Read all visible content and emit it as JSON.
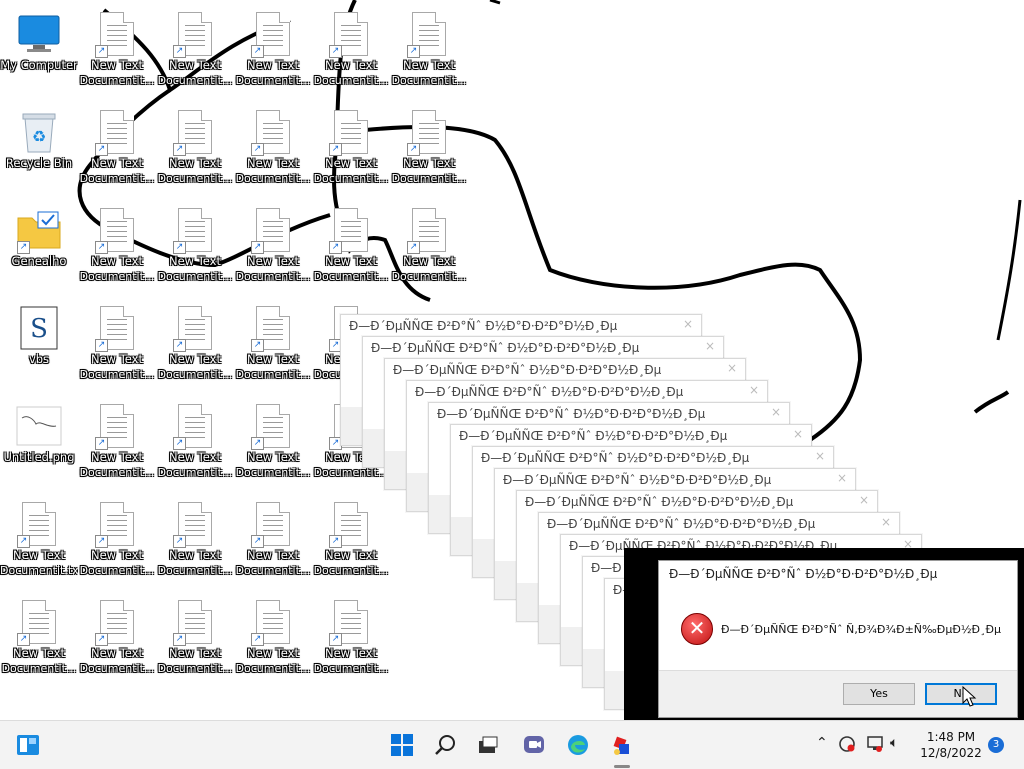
{
  "desktop": {
    "special_icons": {
      "my_computer": "My Computer",
      "recycle_bin": "Recycle Bin",
      "genealho": "Genealho",
      "vbs": "vbs",
      "untitled": "Untitled.png"
    },
    "text_files": [
      {
        "name": "New Text Documentit...",
        "label_lines": [
          "New Text",
          "Documentit..."
        ]
      },
      {
        "name": "New Text Documentit...",
        "label_lines": [
          "New Text",
          "Documentit..."
        ]
      },
      {
        "name": "New Text Documentit...",
        "label_lines": [
          "New Text",
          "Documentit..."
        ]
      },
      {
        "name": "New Text Documentit...",
        "label_lines": [
          "New Text",
          "Documentit..."
        ]
      },
      {
        "name": "New Text Documentit...",
        "label_lines": [
          "New Text",
          "Documentit..."
        ]
      },
      {
        "name": "New Text Documentit...",
        "label_lines": [
          "New Text",
          "Documentit..."
        ]
      }
    ],
    "doc_label_1": "New Text",
    "doc_label_2": "Documentit...",
    "doc_label_2_alt": "Documentit.txt"
  },
  "error_dialog": {
    "title": "Ð—Ð´ÐµÑÑŒ Ð²Ð°Ñˆ Ð½Ð°Ð·Ð²Ð°Ð½Ð¸Ðµ",
    "message": "Ð—Ð´ÐµÑÑŒ Ð²Ð°Ñˆ Ñ‚Ð¾Ð¾Ð±Ñ‰ÐµÐ½Ð¸Ðµ",
    "yes_label": "Yes",
    "no_label": "No",
    "close_glyph": "×"
  },
  "taskbar": {
    "time": "1:48 PM",
    "date": "12/8/2022",
    "notification_count": "3",
    "icons": [
      "widgets-icon",
      "start-icon",
      "search-icon",
      "file-explorer-icon",
      "teams-chat-icon",
      "edge-icon",
      "app-icon"
    ]
  },
  "colors": {
    "accent": "#0078d7",
    "error": "#c11212",
    "taskbar": "#f3f3f3"
  }
}
